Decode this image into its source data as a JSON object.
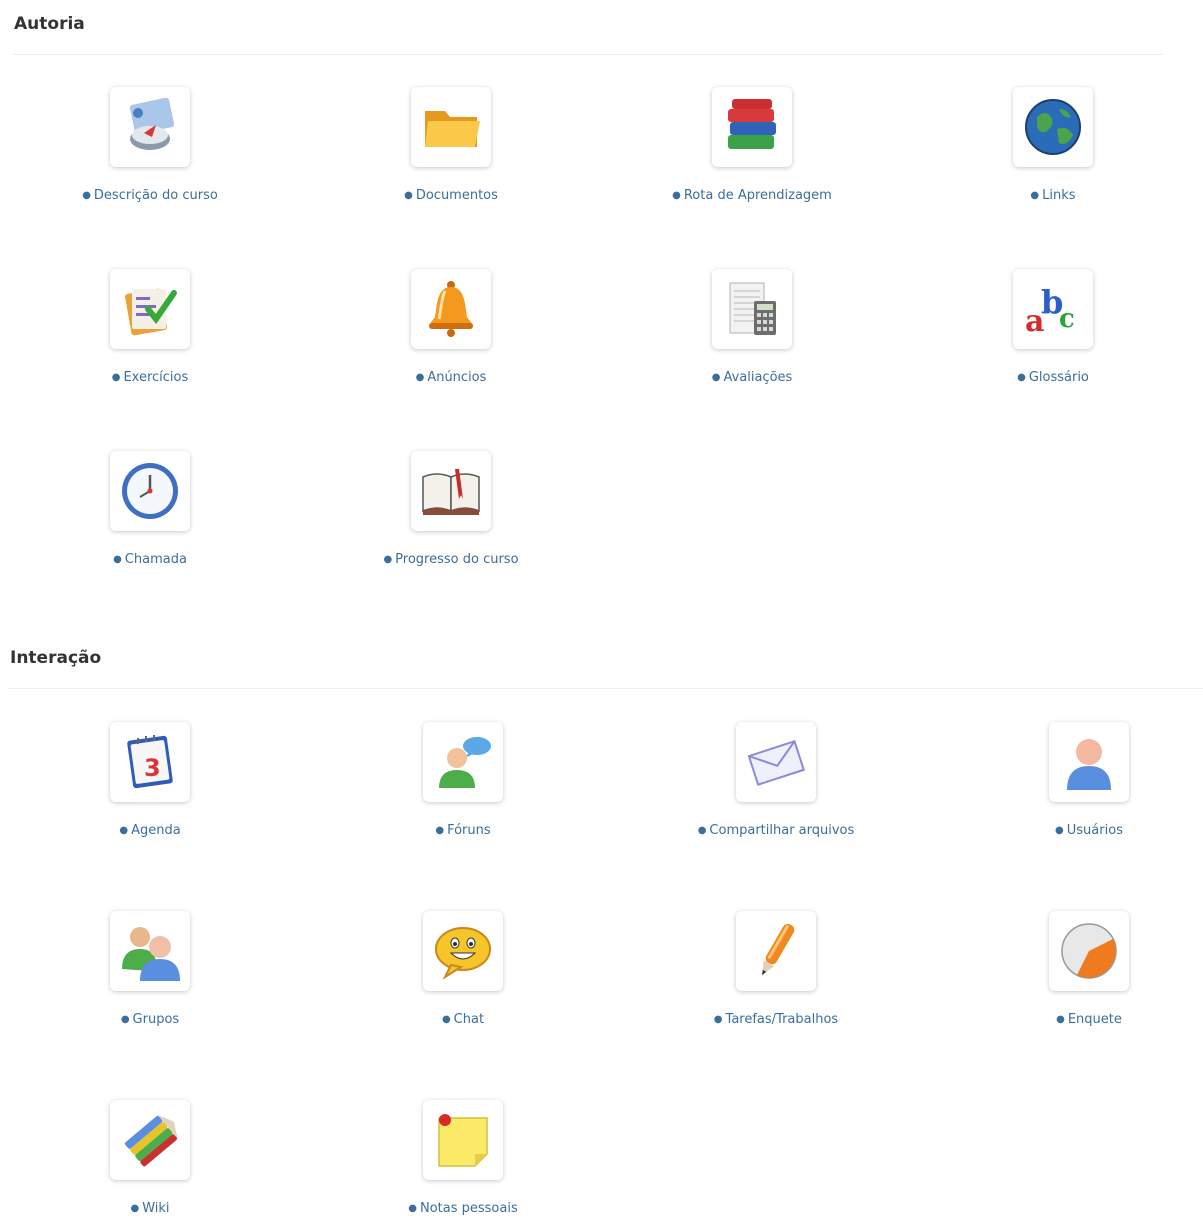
{
  "sections": [
    {
      "title": "Autoria",
      "tools": [
        {
          "label": "Descrição do curso",
          "icon": "course-description-icon"
        },
        {
          "label": "Documentos",
          "icon": "folder-icon"
        },
        {
          "label": "Rota de Aprendizagem",
          "icon": "books-icon"
        },
        {
          "label": "Links",
          "icon": "globe-icon"
        },
        {
          "label": "Exercícios",
          "icon": "checklist-icon"
        },
        {
          "label": "Anúncios",
          "icon": "bell-icon"
        },
        {
          "label": "Avaliações",
          "icon": "calculator-icon"
        },
        {
          "label": "Glossário",
          "icon": "abc-icon"
        },
        {
          "label": "Chamada",
          "icon": "clock-icon"
        },
        {
          "label": "Progresso do curso",
          "icon": "open-book-icon"
        }
      ]
    },
    {
      "title": "Interação",
      "tools": [
        {
          "label": "Agenda",
          "icon": "calendar-icon"
        },
        {
          "label": "Fóruns",
          "icon": "forum-icon"
        },
        {
          "label": "Compartilhar arquivos",
          "icon": "envelope-icon"
        },
        {
          "label": "Usuários",
          "icon": "user-icon"
        },
        {
          "label": "Grupos",
          "icon": "group-icon"
        },
        {
          "label": "Chat",
          "icon": "chat-icon"
        },
        {
          "label": "Tarefas/Trabalhos",
          "icon": "pen-icon"
        },
        {
          "label": "Enquete",
          "icon": "poll-icon"
        },
        {
          "label": "Wiki",
          "icon": "pencils-icon"
        },
        {
          "label": "Notas pessoais",
          "icon": "sticky-note-icon"
        }
      ]
    }
  ]
}
